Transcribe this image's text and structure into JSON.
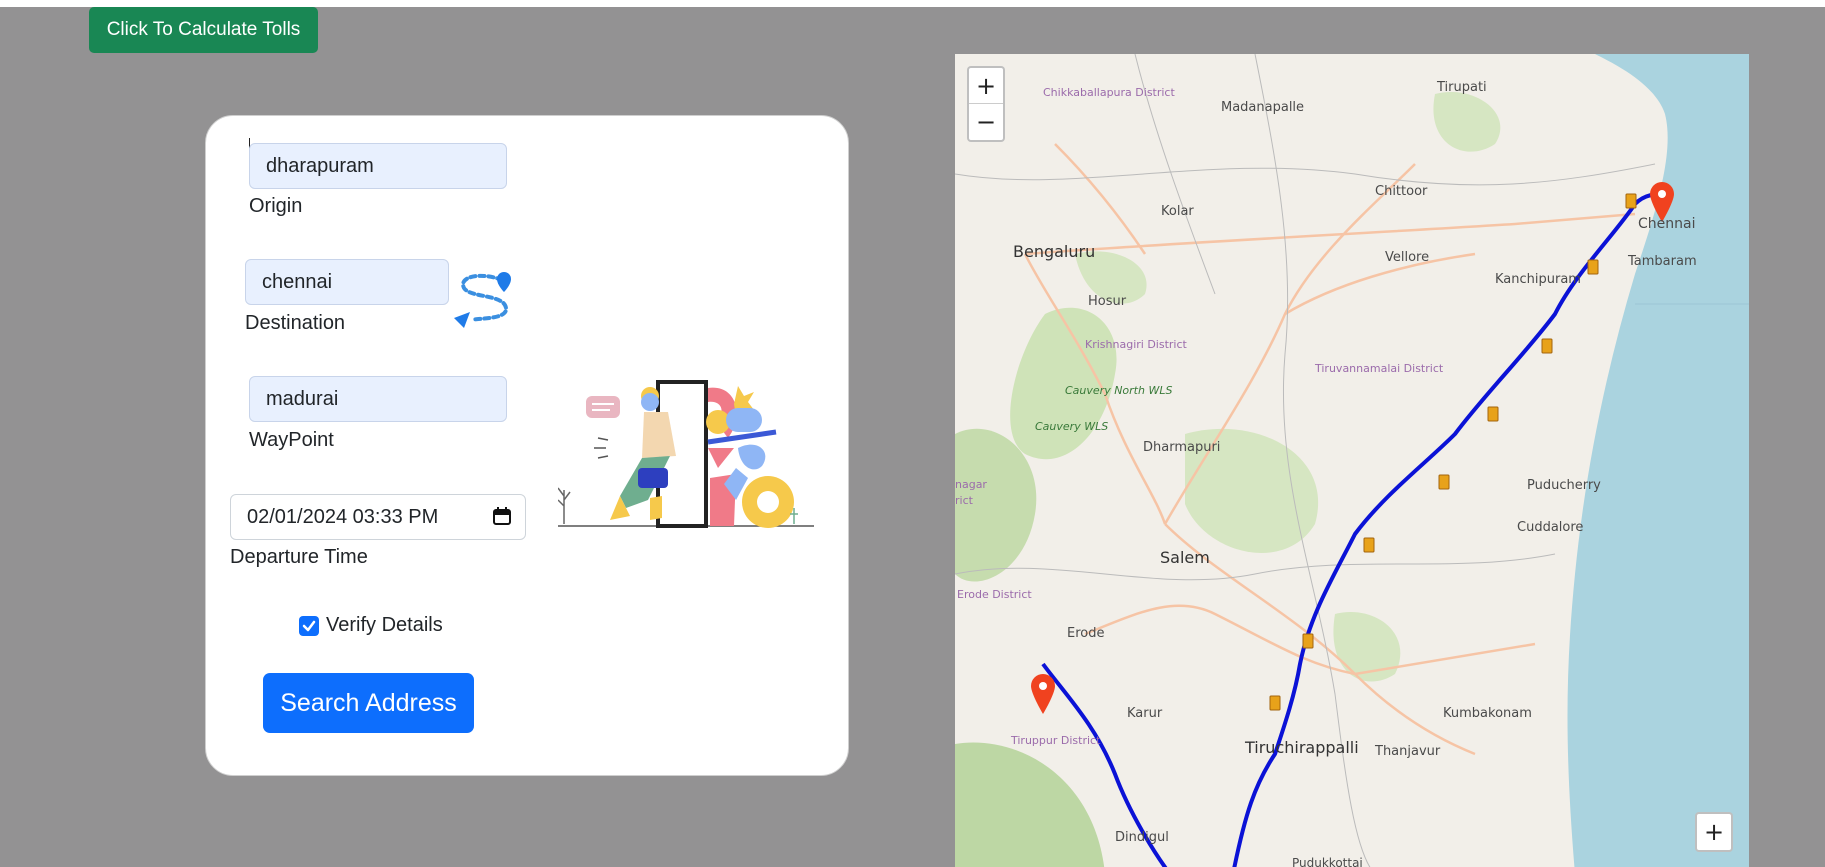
{
  "header": {
    "calculate_button_label": "Click To Calculate Tolls"
  },
  "form": {
    "origin": {
      "value": "dharapuram",
      "label": "Origin"
    },
    "destination": {
      "value": "chennai",
      "label": "Destination"
    },
    "waypoint": {
      "value": "madurai",
      "label": "WayPoint"
    },
    "departure": {
      "value": "02/01/2024 03:33  PM",
      "label": "Departure Time"
    },
    "verify": {
      "label": "Verify Details",
      "checked": true
    },
    "search_button_label": "Search Address"
  },
  "map": {
    "zoom_in": "+",
    "zoom_out": "−",
    "places": {
      "tirupati": "Tirupati",
      "chikkaballapura": "Chikkaballapura District",
      "madanapalle": "Madanapalle",
      "chittoor": "Chittoor",
      "kolar": "Kolar",
      "bengaluru": "Bengaluru",
      "vellore": "Vellore",
      "kanchipuram": "Kanchipuram",
      "chennai": "Chennai",
      "tambaram": "Tambaram",
      "hosur": "Hosur",
      "krishnagiri": "Krishnagiri District",
      "cauvery_north": "Cauvery North WLS",
      "cauvery": "Cauvery WLS",
      "tiruvannamalai": "Tiruvannamalai District",
      "dharmapuri": "Dharmapuri",
      "puducherry": "Puducherry",
      "cuddalore": "Cuddalore",
      "salem": "Salem",
      "erode_district": "Erode District",
      "erode": "Erode",
      "karur": "Karur",
      "kumbakonam": "Kumbakonam",
      "tiruchirappalli": "Tiruchirappalli",
      "thanjavur": "Thanjavur",
      "tiruppur": "Tiruppur District",
      "dindigul": "Dindigul",
      "pudukkottai": "Pudukkottai",
      "nagar": "nagar",
      "rict": "rict"
    },
    "colors": {
      "route": "#0b12d6",
      "marker": "#f0421f",
      "sea": "#aad3df",
      "land": "#f2efe9"
    }
  }
}
